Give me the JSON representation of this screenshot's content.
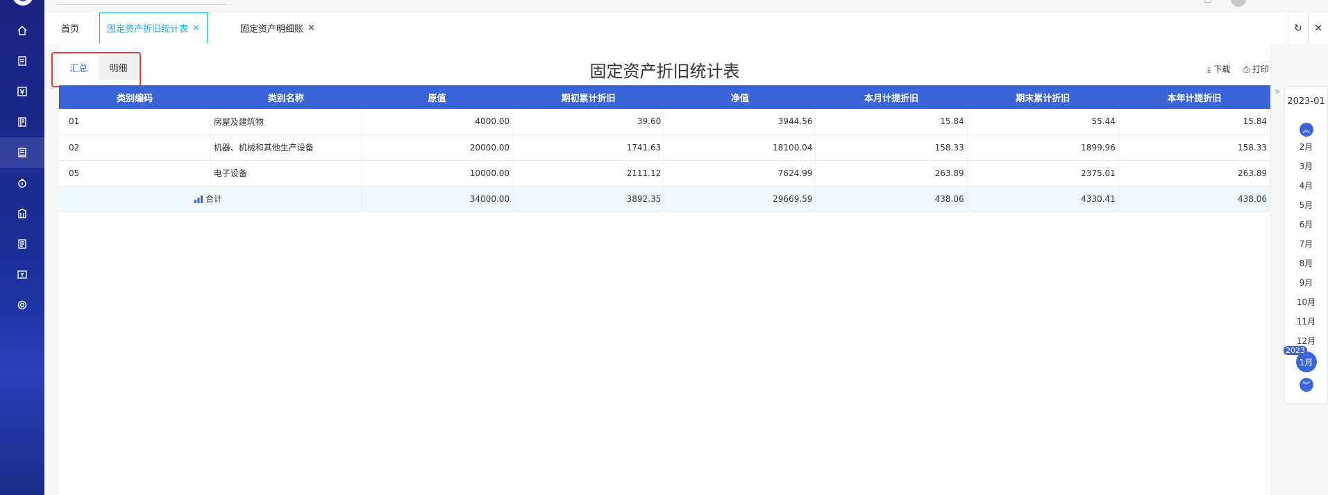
{
  "tabs": [
    {
      "label": "首页",
      "closable": false
    },
    {
      "label": "固定资产折旧统计表",
      "closable": true,
      "active": true
    },
    {
      "label": "固定资产明细账",
      "closable": true
    }
  ],
  "tab_close_glyph": "×",
  "view_switch": {
    "summary": "汇总",
    "detail": "明细"
  },
  "page_title": "固定资产折旧统计表",
  "actions": {
    "download": "下载",
    "print": "打印"
  },
  "table": {
    "headers": [
      "类别编码",
      "类别名称",
      "原值",
      "期初累计折旧",
      "净值",
      "本月计提折旧",
      "期末累计折旧",
      "本年计提折旧"
    ],
    "rows": [
      [
        "01",
        "房屋及建筑物",
        "4000.00",
        "39.60",
        "3944.56",
        "15.84",
        "55.44",
        "15.84"
      ],
      [
        "02",
        "机器、机械和其他生产设备",
        "20000.00",
        "1741.63",
        "18100.04",
        "158.33",
        "1899.96",
        "158.33"
      ],
      [
        "05",
        "电子设备",
        "10000.00",
        "2111.12",
        "7624.99",
        "263.89",
        "2375.01",
        "263.89"
      ]
    ],
    "total": {
      "label": "合计",
      "values": [
        "34000.00",
        "3892.35",
        "29669.59",
        "438.06",
        "4330.41",
        "438.06"
      ]
    }
  },
  "period": {
    "selected": "2023-01",
    "months": [
      "2月",
      "3月",
      "4月",
      "5月",
      "6月",
      "7月",
      "8月",
      "9月",
      "10月",
      "11月",
      "12月"
    ],
    "current_month": "1月",
    "current_year": "2023"
  },
  "colors": {
    "accent": "#3b64d8",
    "tab_active": "#1ab0e6",
    "highlight_border": "#e53935"
  }
}
